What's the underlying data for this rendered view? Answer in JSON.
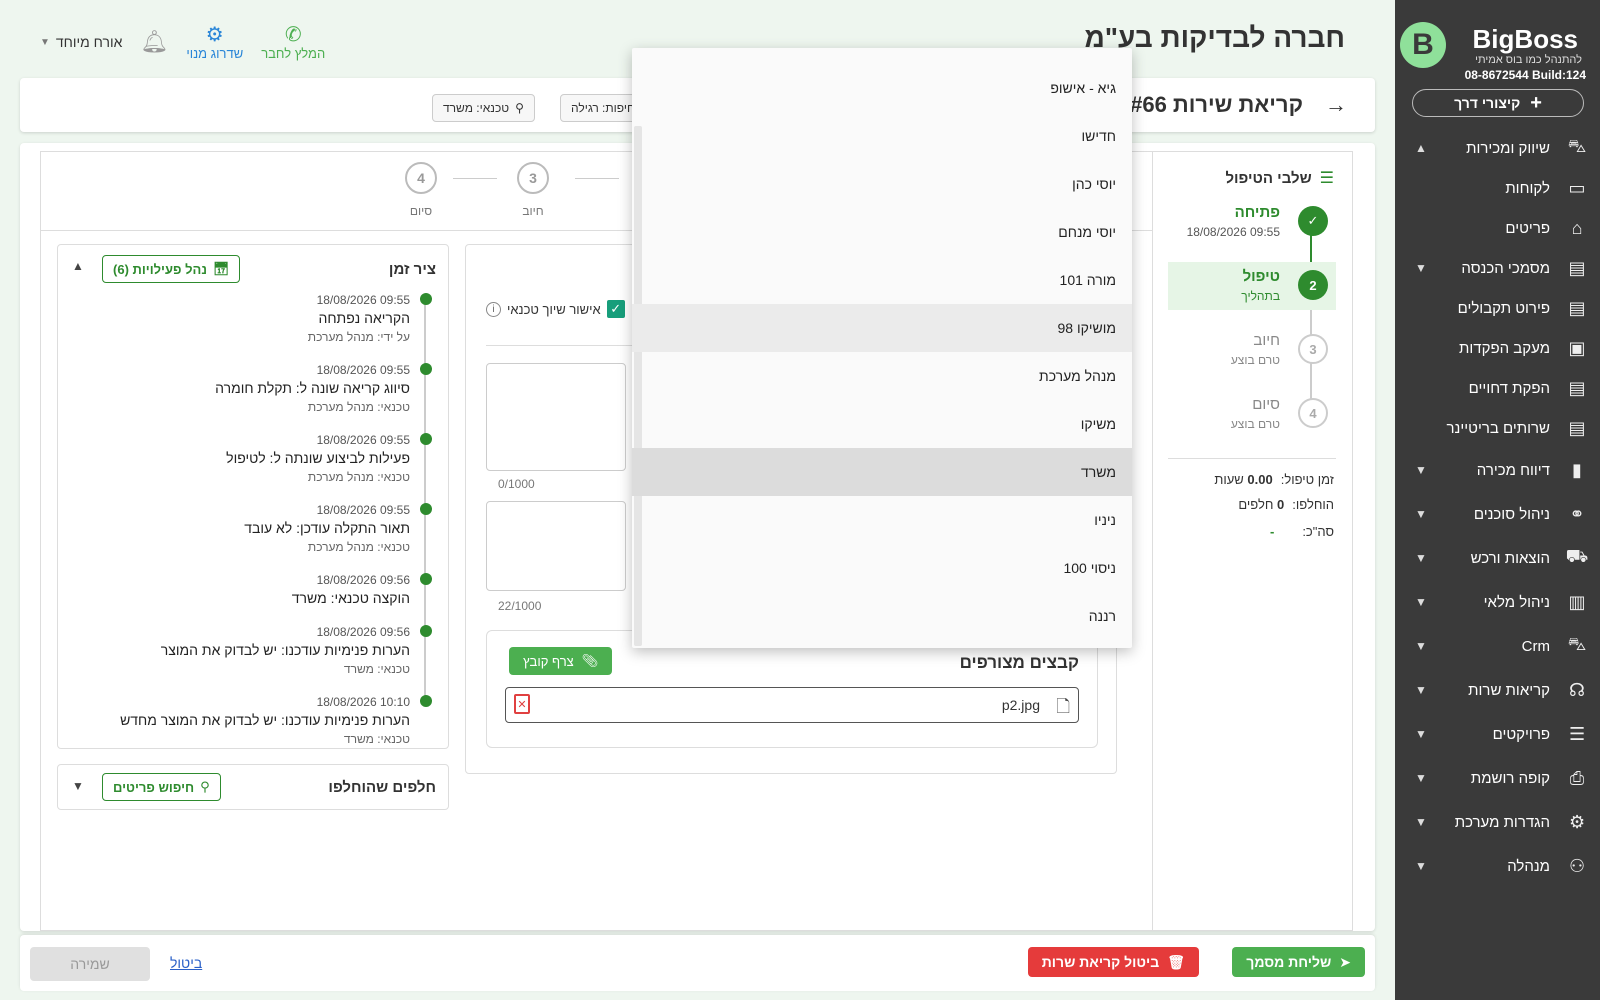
{
  "brand": {
    "name": "BigBoss",
    "tagline": "להתנהל כמו בוס אמיתי",
    "phone": "08-8672544",
    "build": "Build:124",
    "shortcut_label": "קיצורי דרך"
  },
  "nav": [
    {
      "label": "שיווק ומכירות",
      "icon": "shopping-bag-icon",
      "chev": "up"
    },
    {
      "label": "לקוחות",
      "icon": "contact-card-icon",
      "chev": ""
    },
    {
      "label": "פריטים",
      "icon": "store-icon",
      "chev": ""
    },
    {
      "label": "מסמכי הכנסה",
      "icon": "document-icon",
      "chev": "down"
    },
    {
      "label": "פירוט תקבולים",
      "icon": "document-icon",
      "chev": ""
    },
    {
      "label": "מעקב הפקדות",
      "icon": "cash-icon",
      "chev": ""
    },
    {
      "label": "הפקת דחויים",
      "icon": "document-icon",
      "chev": ""
    },
    {
      "label": "שרותים בריטיינר",
      "icon": "document-icon",
      "chev": ""
    },
    {
      "label": "דיווח מכירה",
      "icon": "bar-chart-icon",
      "chev": "down"
    },
    {
      "label": "ניהול סוכנים",
      "icon": "handshake-icon",
      "chev": "down"
    },
    {
      "label": "הוצאות ורכש",
      "icon": "cart-icon",
      "chev": "down"
    },
    {
      "label": "ניהול מלאי",
      "icon": "clipboard-icon",
      "chev": "down"
    },
    {
      "label": "Crm",
      "icon": "shopping-bag-icon",
      "chev": "down"
    },
    {
      "label": "קריאות שרות",
      "icon": "headset-icon",
      "chev": "down"
    },
    {
      "label": "פרויקטים",
      "icon": "list-icon",
      "chev": "down"
    },
    {
      "label": "קופה רושמת",
      "icon": "register-icon",
      "chev": "down"
    },
    {
      "label": "הגדרות מערכת",
      "icon": "gear-icon",
      "chev": "down"
    },
    {
      "label": "מנהלה",
      "icon": "admin-icon",
      "chev": "down"
    }
  ],
  "top": {
    "company": "חברה לבדיקות בע\"מ",
    "recommend": "המלץ לחבר",
    "upgrade": "שדרוג מנוי",
    "user": "אורח מיוחד"
  },
  "header": {
    "title": "קריאת שירות #66",
    "chip_priority": "דחיפות: רגילה",
    "chip_tech": "טכנאי: משרד"
  },
  "steps": {
    "title": "שלבי הטיפול",
    "items": [
      {
        "name": "פתיחה",
        "sub": "09:55 18/08/2026",
        "state": "done"
      },
      {
        "name": "טיפול",
        "sub": "בתהליך",
        "state": "cur",
        "num": "2"
      },
      {
        "name": "חיוב",
        "sub": "טרם בוצע",
        "state": "todo",
        "num": "3"
      },
      {
        "name": "סיום",
        "sub": "טרם בוצע",
        "state": "todo",
        "num": "4"
      }
    ],
    "time_label": "זמן טיפול:",
    "time_value": "0.00",
    "time_unit": "שעות",
    "replaced_label": "הוחלפו:",
    "replaced_value": "0",
    "replaced_unit": "חלפים",
    "total_label": "סה\"כ:",
    "total_value": "-"
  },
  "hsteps": [
    {
      "num": "4",
      "label": "סיום"
    },
    {
      "num": "3",
      "label": "חיוב"
    }
  ],
  "form": {
    "approve_label": "אישור שיוך טכנאי",
    "counter1": "0/1000",
    "counter2": "22/1000",
    "files_title": "קבצים מצורפים",
    "attach_label": "צרף קובץ",
    "file_name": "p2.jpg"
  },
  "timeline": {
    "title": "ציר זמן",
    "manage_label": "נהל פעילויות (6)",
    "events": [
      {
        "date": "09:55 18/08/2026",
        "text": "הקריאה נפתחה",
        "by": "על ידי: מנהל מערכת"
      },
      {
        "date": "09:55 18/08/2026",
        "text": "סיווג קריאה שונה ל: תקלת חומרה",
        "by": "טכנאי: מנהל מערכת"
      },
      {
        "date": "09:55 18/08/2026",
        "text": "פעילות לביצוע שונתה ל: לטיפול",
        "by": "טכנאי: מנהל מערכת"
      },
      {
        "date": "09:55 18/08/2026",
        "text": "תאור התקלה עודכן: לא עובד",
        "by": "טכנאי: מנהל מערכת"
      },
      {
        "date": "09:56 18/08/2026",
        "text": "הוקצה טכנאי: משרד",
        "by": ""
      },
      {
        "date": "09:56 18/08/2026",
        "text": "הערות פנימיות עודכנו: יש לבדוק את המוצר",
        "by": "טכנאי: משרד"
      },
      {
        "date": "10:10 18/08/2026",
        "text": "הערות פנימיות עודכנו: יש לבדוק את המוצר מחדש",
        "by": "טכנאי: משרד"
      }
    ]
  },
  "parts": {
    "title": "חלפים שהוחלפו",
    "search_label": "חיפוש פריטים"
  },
  "dropdown": {
    "options": [
      "גיא - אישופ",
      "חדישו",
      "יוסי כהן",
      "יוסי מנחם",
      "מורה 101",
      "מושיקו 98",
      "מנהל מערכת",
      "משיקו",
      "משרד",
      "ניניו",
      "ניסוי 100",
      "רננה"
    ],
    "hover_index": 5,
    "selected_index": 8
  },
  "footer": {
    "send_label": "שליחת מסמך",
    "cancel_call_label": "ביטול קריאת שרות",
    "cancel_label": "ביטול",
    "save_label": "שמירה"
  }
}
